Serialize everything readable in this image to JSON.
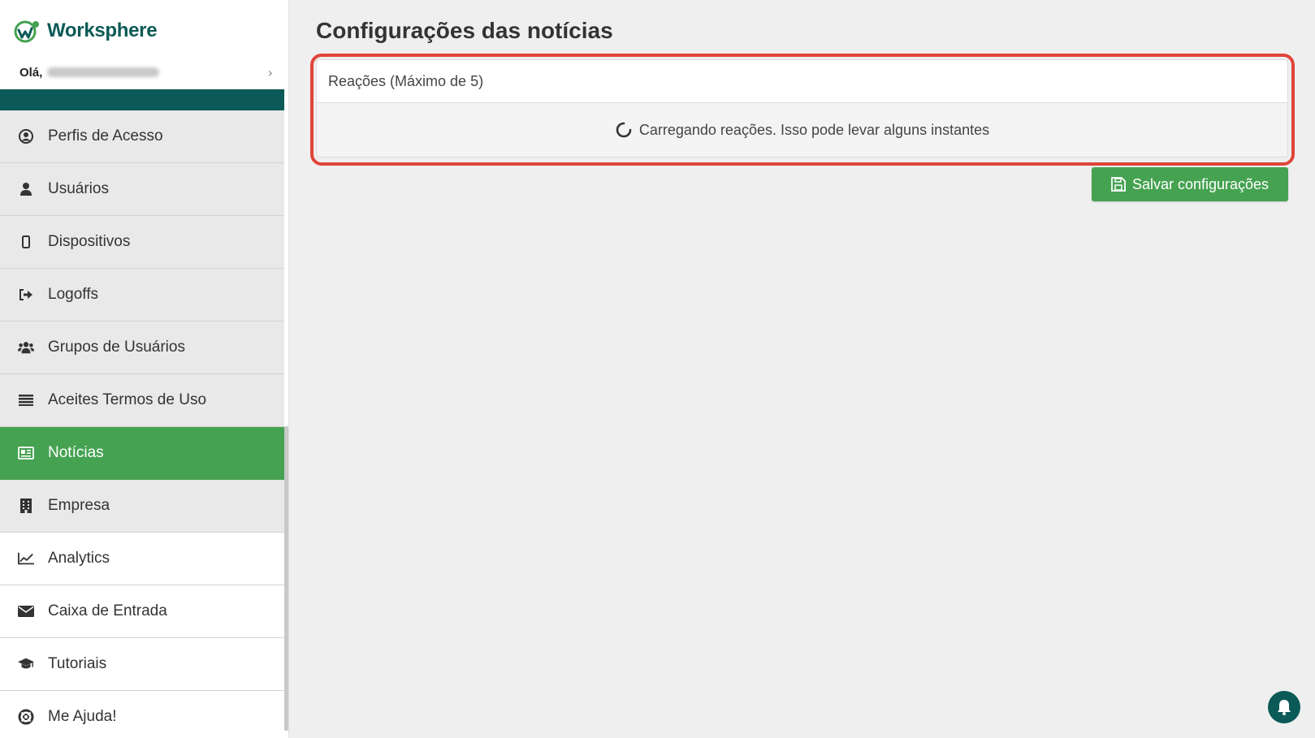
{
  "app": {
    "brand_name": "Worksphere",
    "greeting_label": "Olá,",
    "colors": {
      "accent": "#45a251",
      "brand": "#0b5a57",
      "highlight": "#e0443a"
    }
  },
  "sidebar": {
    "items": [
      {
        "label": "Perfis de Acesso",
        "icon": "user-circle-icon"
      },
      {
        "label": "Usuários",
        "icon": "user-icon"
      },
      {
        "label": "Dispositivos",
        "icon": "mobile-icon"
      },
      {
        "label": "Logoffs",
        "icon": "sign-out-icon"
      },
      {
        "label": "Grupos de Usuários",
        "icon": "users-icon"
      },
      {
        "label": "Aceites Termos de Uso",
        "icon": "list-icon"
      },
      {
        "label": "Notícias",
        "icon": "newspaper-icon",
        "active": true
      },
      {
        "label": "Empresa",
        "icon": "building-icon"
      },
      {
        "label": "Analytics",
        "icon": "line-chart-icon"
      },
      {
        "label": "Caixa de Entrada",
        "icon": "envelope-icon"
      },
      {
        "label": "Tutoriais",
        "icon": "graduation-cap-icon"
      },
      {
        "label": "Me Ajuda!",
        "icon": "life-ring-icon"
      }
    ]
  },
  "main": {
    "title": "Configurações das notícias",
    "reactions_card": {
      "header": "Reações (Máximo de 5)",
      "loading_text": "Carregando reações. Isso pode levar alguns instantes"
    },
    "save_label": "Salvar configurações"
  }
}
